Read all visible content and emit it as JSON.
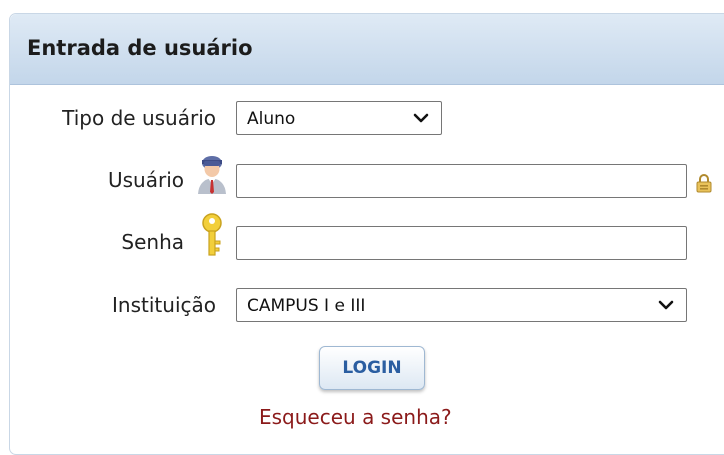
{
  "panel": {
    "title": "Entrada de usuário"
  },
  "form": {
    "user_type_label": "Tipo de usuário",
    "user_type_value": "Aluno",
    "username_label": "Usuário",
    "username_value": "",
    "password_label": "Senha",
    "password_value": "",
    "institution_label": "Instituição",
    "institution_value": "CAMPUS I e III",
    "login_label": "LOGIN",
    "forgot_label": "Esqueceu a senha?"
  },
  "icons": {
    "username": "user-icon",
    "password": "key-icon",
    "keyboard": "lock-icon",
    "dropdown": "chevron-down-icon"
  },
  "colors": {
    "header_bg": "#c3d6ea",
    "login_text": "#2b5ea1",
    "forgot_link": "#8b1a1a"
  }
}
